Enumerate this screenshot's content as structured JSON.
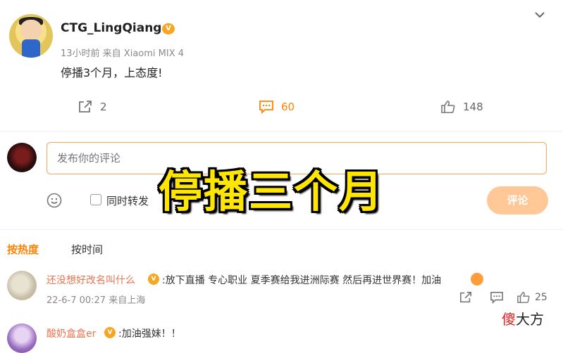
{
  "post": {
    "username": "CTG_LingQiang",
    "meta": "13小时前 来自 Xiaomi MIX 4",
    "text": "停播3个月，上态度!",
    "share_count": "2",
    "comment_count": "60",
    "like_count": "148"
  },
  "composer": {
    "placeholder": "发布你的评论",
    "repost_label": "同时转发",
    "submit_label": "评论"
  },
  "overlay_caption": "停播三个月",
  "sort_tabs": {
    "hot": "按热度",
    "time": "按时间"
  },
  "comments": [
    {
      "username": "还没想好改名叫什么",
      "text": ":放下直播 专心职业 夏季赛给我进洲际赛 然后再进世界赛！加油",
      "meta": "22-6-7 00:27 来自上海",
      "like_count": "25"
    },
    {
      "username": "酸奶盒盒er",
      "text": ":加油强妹！！"
    }
  ],
  "watermark": {
    "part1": "傻",
    "part2": "大方"
  },
  "colors": {
    "accent": "#ff8200",
    "username_link": "#eb7350",
    "overlay": "#ffe600"
  },
  "icons": [
    "chevron-down-icon",
    "share-icon",
    "comment-icon",
    "like-icon",
    "emoji-icon",
    "vip-icon"
  ]
}
